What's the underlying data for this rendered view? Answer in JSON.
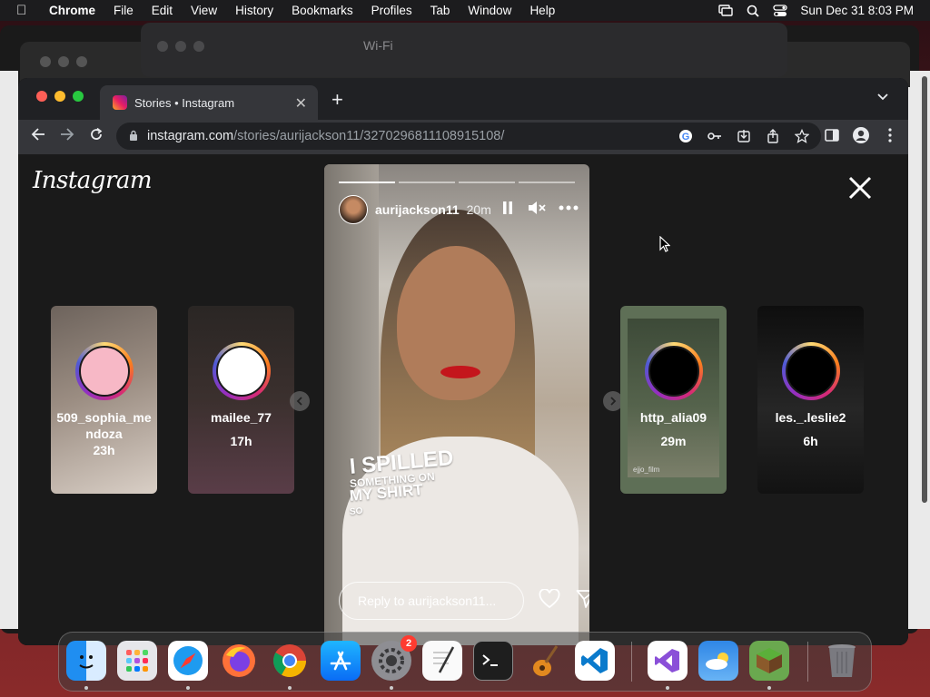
{
  "menubar": {
    "app": "Chrome",
    "items": [
      "File",
      "Edit",
      "View",
      "History",
      "Bookmarks",
      "Profiles",
      "Tab",
      "Window",
      "Help"
    ],
    "datetime": "Sun Dec 31  8:03 PM"
  },
  "background_window": {
    "title": "Wi-Fi"
  },
  "browser": {
    "tab_title": "Stories • Instagram",
    "url_host": "instagram.com",
    "url_path": "/stories/aurijackson11/3270296811108915108/"
  },
  "instagram": {
    "logo": "Instagram",
    "current_story": {
      "username": "aurijackson11",
      "age": "20m",
      "overlay_line1": "I SPILLED",
      "overlay_line2": "SOMETHING ON",
      "overlay_line3": "MY SHIRT",
      "overlay_line4": "SO",
      "reply_placeholder": "Reply to aurijackson11..."
    },
    "side_stories": [
      {
        "username": "509_sophia_me\nndoza",
        "time": "23h"
      },
      {
        "username": "mailee_77",
        "time": "17h"
      },
      {
        "username": "http_alia09",
        "time": "29m",
        "watermark": "ejjo_film"
      },
      {
        "username": "les._.leslie2",
        "time": "6h"
      }
    ]
  },
  "dock": {
    "apps": [
      "Finder",
      "Launchpad",
      "Safari",
      "Firefox",
      "Chrome",
      "App Store",
      "System Settings",
      "TextEdit",
      "Terminal",
      "GarageBand",
      "VS Code",
      "Visual Studio",
      "Weather",
      "Minecraft",
      "Trash"
    ],
    "settings_badge": "2"
  },
  "colors": {
    "story_ring_start": "#feda75",
    "story_ring_end": "#962fbf",
    "badge": "#ff3b30",
    "lips": "#c4161c"
  }
}
